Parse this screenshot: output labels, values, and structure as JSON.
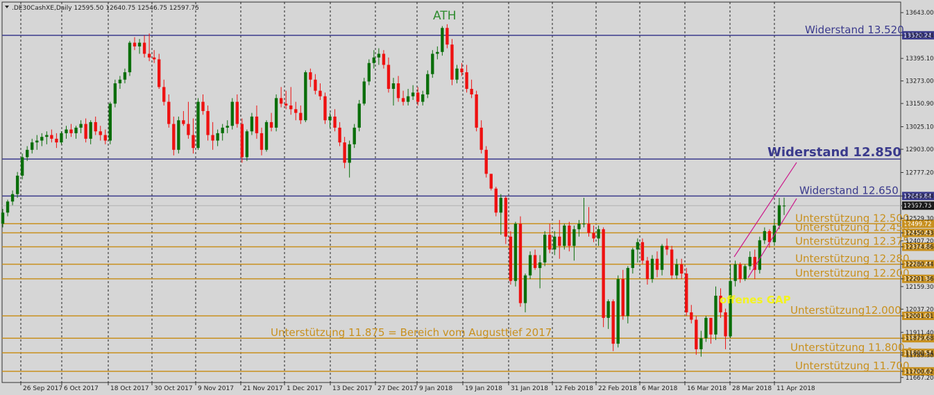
{
  "header": {
    "symbol_line": ".DE30CashXE,Daily  12595.50 12640.75 12546.75 12597.75"
  },
  "colors": {
    "background": "#d6d6d6",
    "up": "#0a6e0a",
    "down": "#ee1111",
    "resistance": "#3a3a8c",
    "support": "#c8901e",
    "channel": "#cc1a8c",
    "gap_label": "#f3f31e",
    "ath_label": "#2e8b2e"
  },
  "chart_data": {
    "type": "candlestick",
    "title": ".DE30CashXE,Daily",
    "ylim": [
      11640,
      13700
    ],
    "y_ticks": [
      "13643.00",
      "13520.24",
      "13395.10",
      "13273.00",
      "13150.90",
      "13025.10",
      "12903.00",
      "12777.20",
      "12649.84",
      "12597.75",
      "12529.30",
      "12450.43",
      "12407.20",
      "12374.86",
      "12280.44",
      "12201.36",
      "12159.30",
      "12037.20",
      "12001.01",
      "11911.40",
      "11879.68",
      "11800.54",
      "11789.30",
      "11700.62",
      "11667.20"
    ],
    "x_labels": [
      "26 Sep 2017",
      "6 Oct 2017",
      "18 Oct 2017",
      "30 Oct 2017",
      "9 Nov 2017",
      "21 Nov 2017",
      "1 Dec 2017",
      "13 Dec 2017",
      "27 Dec 2017",
      "9 Jan 2018",
      "19 Jan 2018",
      "31 Jan 2018",
      "12 Feb 2018",
      "22 Feb 2018",
      "6 Mar 2018",
      "16 Mar 2018",
      "28 Mar 2018",
      "11 Apr 2018"
    ],
    "candles": [
      [
        12500,
        12580,
        12480,
        12560
      ],
      [
        12560,
        12630,
        12540,
        12620
      ],
      [
        12620,
        12680,
        12600,
        12660
      ],
      [
        12660,
        12780,
        12640,
        12760
      ],
      [
        12760,
        12880,
        12740,
        12860
      ],
      [
        12860,
        12920,
        12840,
        12900
      ],
      [
        12900,
        12960,
        12880,
        12940
      ],
      [
        12940,
        12980,
        12900,
        12950
      ],
      [
        12950,
        12990,
        12920,
        12970
      ],
      [
        12970,
        13000,
        12930,
        12980
      ],
      [
        12980,
        13010,
        12940,
        12960
      ],
      [
        12960,
        12990,
        12910,
        12940
      ],
      [
        12940,
        13000,
        12930,
        12990
      ],
      [
        12990,
        13030,
        12960,
        13010
      ],
      [
        13010,
        13040,
        12970,
        12990
      ],
      [
        12990,
        13030,
        12960,
        13020
      ],
      [
        13020,
        13060,
        12990,
        13040
      ],
      [
        13040,
        13070,
        12940,
        12960
      ],
      [
        12960,
        13060,
        12930,
        13050
      ],
      [
        13050,
        13080,
        12980,
        13000
      ],
      [
        13000,
        13030,
        12950,
        12980
      ],
      [
        12980,
        13010,
        12930,
        12950
      ],
      [
        12950,
        13160,
        12930,
        13150
      ],
      [
        13150,
        13280,
        13130,
        13260
      ],
      [
        13260,
        13300,
        13230,
        13280
      ],
      [
        13280,
        13340,
        13260,
        13320
      ],
      [
        13320,
        13490,
        13300,
        13480
      ],
      [
        13480,
        13510,
        13440,
        13460
      ],
      [
        13460,
        13500,
        13420,
        13480
      ],
      [
        13480,
        13520,
        13400,
        13420
      ],
      [
        13420,
        13530,
        13380,
        13400
      ],
      [
        13400,
        13440,
        13370,
        13390
      ],
      [
        13390,
        13420,
        13230,
        13240
      ],
      [
        13240,
        13280,
        13140,
        13160
      ],
      [
        13160,
        13200,
        13020,
        13040
      ],
      [
        13040,
        13080,
        12870,
        12900
      ],
      [
        12900,
        13080,
        12880,
        13060
      ],
      [
        13060,
        13110,
        13030,
        13040
      ],
      [
        13040,
        13160,
        12960,
        12980
      ],
      [
        12980,
        13070,
        12880,
        12910
      ],
      [
        12910,
        13180,
        12900,
        13160
      ],
      [
        13160,
        13200,
        13090,
        13110
      ],
      [
        13110,
        13140,
        12950,
        12980
      ],
      [
        12980,
        13050,
        12900,
        12950
      ],
      [
        12950,
        13010,
        12920,
        12990
      ],
      [
        12990,
        13040,
        12950,
        13020
      ],
      [
        13020,
        13060,
        12990,
        13030
      ],
      [
        13030,
        13180,
        13010,
        13160
      ],
      [
        13160,
        13200,
        13020,
        13040
      ],
      [
        13040,
        13070,
        12830,
        12860
      ],
      [
        12860,
        13010,
        12840,
        13000
      ],
      [
        13000,
        13100,
        12980,
        13080
      ],
      [
        13080,
        13140,
        12960,
        12990
      ],
      [
        12990,
        13020,
        12870,
        12900
      ],
      [
        12900,
        13060,
        12890,
        13050
      ],
      [
        13050,
        13100,
        13000,
        13020
      ],
      [
        13020,
        13200,
        13000,
        13180
      ],
      [
        13180,
        13240,
        13130,
        13150
      ],
      [
        13150,
        13220,
        13120,
        13140
      ],
      [
        13140,
        13240,
        13090,
        13120
      ],
      [
        13120,
        13160,
        13060,
        13100
      ],
      [
        13100,
        13140,
        13040,
        13060
      ],
      [
        13060,
        13330,
        13050,
        13320
      ],
      [
        13320,
        13340,
        13240,
        13280
      ],
      [
        13280,
        13310,
        13200,
        13220
      ],
      [
        13220,
        13260,
        13170,
        13190
      ],
      [
        13190,
        13210,
        13040,
        13060
      ],
      [
        13060,
        13100,
        13020,
        13080
      ],
      [
        13080,
        13120,
        13000,
        13020
      ],
      [
        13020,
        13050,
        12920,
        12940
      ],
      [
        12940,
        12970,
        12800,
        12830
      ],
      [
        12830,
        12950,
        12750,
        12930
      ],
      [
        12930,
        13040,
        12910,
        13020
      ],
      [
        13020,
        13170,
        13000,
        13150
      ],
      [
        13150,
        13290,
        13140,
        13270
      ],
      [
        13270,
        13390,
        13250,
        13370
      ],
      [
        13370,
        13440,
        13340,
        13400
      ],
      [
        13400,
        13450,
        13360,
        13420
      ],
      [
        13420,
        13440,
        13340,
        13360
      ],
      [
        13360,
        13400,
        13210,
        13230
      ],
      [
        13230,
        13290,
        13140,
        13260
      ],
      [
        13260,
        13300,
        13160,
        13180
      ],
      [
        13180,
        13220,
        13140,
        13160
      ],
      [
        13160,
        13230,
        13140,
        13190
      ],
      [
        13190,
        13250,
        13170,
        13210
      ],
      [
        13210,
        13240,
        13140,
        13160
      ],
      [
        13160,
        13220,
        13140,
        13200
      ],
      [
        13200,
        13330,
        13180,
        13310
      ],
      [
        13310,
        13440,
        13290,
        13420
      ],
      [
        13420,
        13460,
        13390,
        13430
      ],
      [
        13430,
        13570,
        13410,
        13560
      ],
      [
        13560,
        13580,
        13450,
        13470
      ],
      [
        13470,
        13500,
        13250,
        13280
      ],
      [
        13280,
        13360,
        13260,
        13340
      ],
      [
        13340,
        13370,
        13300,
        13320
      ],
      [
        13320,
        13360,
        13210,
        13230
      ],
      [
        13230,
        13280,
        13180,
        13200
      ],
      [
        13200,
        13220,
        13000,
        13020
      ],
      [
        13020,
        13060,
        12880,
        12900
      ],
      [
        12900,
        12920,
        12750,
        12770
      ],
      [
        12770,
        12770,
        12680,
        12690
      ],
      [
        12690,
        12700,
        12540,
        12560
      ],
      [
        12560,
        12660,
        12440,
        12640
      ],
      [
        12640,
        12650,
        12390,
        12430
      ],
      [
        12430,
        12460,
        12170,
        12190
      ],
      [
        12190,
        12510,
        12160,
        12500
      ],
      [
        12500,
        12540,
        12050,
        12070
      ],
      [
        12070,
        12230,
        12020,
        12220
      ],
      [
        12220,
        12350,
        12200,
        12330
      ],
      [
        12330,
        12360,
        12250,
        12260
      ],
      [
        12260,
        12330,
        12150,
        12290
      ],
      [
        12290,
        12460,
        12270,
        12440
      ],
      [
        12440,
        12500,
        12340,
        12360
      ],
      [
        12360,
        12460,
        12330,
        12430
      ],
      [
        12430,
        12520,
        12310,
        12380
      ],
      [
        12380,
        12500,
        12360,
        12490
      ],
      [
        12490,
        12510,
        12350,
        12380
      ],
      [
        12380,
        12490,
        12300,
        12470
      ],
      [
        12470,
        12520,
        12430,
        12500
      ],
      [
        12500,
        12640,
        12480,
        12500
      ],
      [
        12500,
        12590,
        12430,
        12450
      ],
      [
        12450,
        12490,
        12400,
        12420
      ],
      [
        12420,
        12490,
        12380,
        12470
      ],
      [
        12470,
        12480,
        11940,
        11990
      ],
      [
        11990,
        12090,
        11930,
        12080
      ],
      [
        12080,
        12090,
        11810,
        11850
      ],
      [
        11850,
        12220,
        11830,
        12200
      ],
      [
        12200,
        12250,
        11980,
        12000
      ],
      [
        12000,
        12270,
        11960,
        12260
      ],
      [
        12260,
        12370,
        12230,
        12360
      ],
      [
        12360,
        12420,
        12290,
        12400
      ],
      [
        12400,
        12420,
        12280,
        12300
      ],
      [
        12300,
        12320,
        12170,
        12200
      ],
      [
        12200,
        12330,
        12180,
        12310
      ],
      [
        12310,
        12350,
        12210,
        12250
      ],
      [
        12250,
        12390,
        12220,
        12380
      ],
      [
        12380,
        12420,
        12330,
        12360
      ],
      [
        12360,
        12380,
        12200,
        12220
      ],
      [
        12220,
        12310,
        12200,
        12280
      ],
      [
        12280,
        12310,
        12200,
        12230
      ],
      [
        12230,
        12260,
        12000,
        12020
      ],
      [
        12020,
        12060,
        11960,
        11980
      ],
      [
        11980,
        12000,
        11790,
        11820
      ],
      [
        11820,
        11920,
        11780,
        11880
      ],
      [
        11880,
        12000,
        11860,
        11990
      ],
      [
        11990,
        11990,
        11850,
        11900
      ],
      [
        11900,
        12160,
        11870,
        12110
      ],
      [
        12110,
        12150,
        11990,
        12020
      ],
      [
        12020,
        12040,
        11820,
        11890
      ],
      [
        11890,
        12280,
        11880,
        12190
      ],
      [
        12190,
        12300,
        12160,
        12280
      ],
      [
        12280,
        12290,
        12180,
        12200
      ],
      [
        12200,
        12280,
        12190,
        12270
      ],
      [
        12270,
        12350,
        12250,
        12320
      ],
      [
        12320,
        12360,
        12200,
        12250
      ],
      [
        12250,
        12430,
        12230,
        12410
      ],
      [
        12410,
        12480,
        12390,
        12460
      ],
      [
        12460,
        12470,
        12370,
        12400
      ],
      [
        12400,
        12520,
        12380,
        12490
      ],
      [
        12490,
        12640,
        12470,
        12600
      ],
      [
        12595.5,
        12640.75,
        12546.75,
        12597.75
      ]
    ],
    "annotations": {
      "ath": "ATH",
      "gap": "offenes GAP"
    },
    "levels": [
      {
        "value": 13520.24,
        "label": "Widerstand 13.520",
        "price_tag": "13520.24",
        "kind": "resistance",
        "bold": false
      },
      {
        "value": 12850,
        "label": "Widerstand 12.850",
        "price_tag": "",
        "kind": "resistance",
        "bold": true
      },
      {
        "value": 12649.84,
        "label": "Widerstand 12.650",
        "price_tag": "12649.84",
        "kind": "resistance",
        "bold": false
      },
      {
        "value": 12499.72,
        "label": "Unterstützung 12.500",
        "price_tag": "12499.72",
        "kind": "support",
        "bold": false
      },
      {
        "value": 12450.43,
        "label": "Unterstützung 12.450",
        "price_tag": "12450.43",
        "kind": "support",
        "bold": false
      },
      {
        "value": 12374.86,
        "label": "Unterstützung 12.375",
        "price_tag": "12374.86",
        "kind": "support",
        "bold": false
      },
      {
        "value": 12280.44,
        "label": "Unterstützung 12.280",
        "price_tag": "12280.44",
        "kind": "support",
        "bold": false
      },
      {
        "value": 12201.36,
        "label": "Unterstützung 12.200",
        "price_tag": "12201.36",
        "kind": "support",
        "bold": false
      },
      {
        "value": 12001.01,
        "label": "Unterstützung12.000",
        "price_tag": "12001.01",
        "kind": "support",
        "bold": false
      },
      {
        "value": 11879.68,
        "label": "Unterstützung 11.875 = Bereich vom Augusttief 2017",
        "price_tag": "11879.68",
        "kind": "support",
        "bold": false
      },
      {
        "value": 11800.54,
        "label": "Unterstützung 11.800 -",
        "price_tag": "11800.54",
        "kind": "support",
        "bold": false
      },
      {
        "value": 11700.62,
        "label": "Unterstützung 11.700",
        "price_tag": "11700.62",
        "kind": "support",
        "bold": false
      }
    ],
    "current_price": "12597.75",
    "grid": false,
    "legend": "none"
  }
}
